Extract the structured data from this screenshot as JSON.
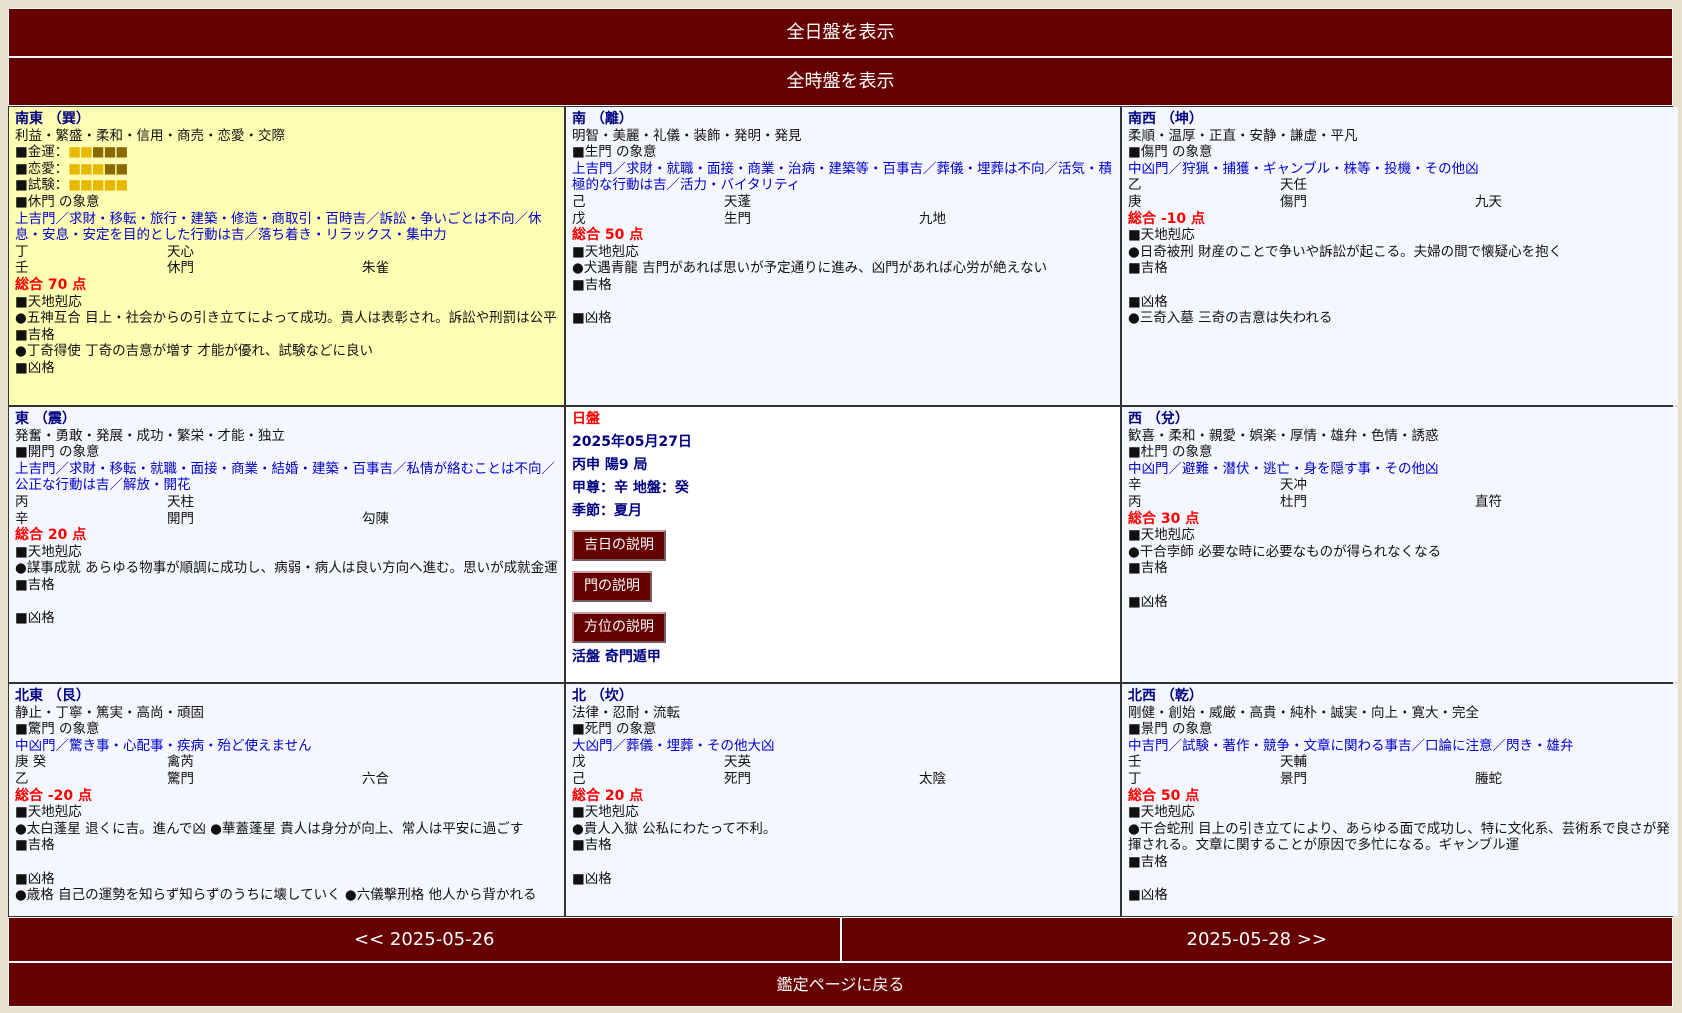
{
  "header": {
    "day_chart_button": "全日盤を表示",
    "hour_chart_button": "全時盤を表示"
  },
  "cells": {
    "se": {
      "direction": "南東 （巽）",
      "keywords": "利益・繁盛・柔和・信用・商売・恋愛・交際",
      "luck": [
        {
          "label": "■金運：",
          "filled": 2,
          "total": 5
        },
        {
          "label": "■恋愛：",
          "filled": 3,
          "total": 5
        },
        {
          "label": "■試験：",
          "filled": 5,
          "total": 5
        }
      ],
      "gate_meaning": "■休門 の象意",
      "gate_text": "上吉門／求財・移転・旅行・建築・修造・商取引・百時吉／訴訟・争いごとは不向／休息・安息・安定を目的とした行動は吉／落ち着き・リラックス・集中力",
      "row1": [
        "丁",
        "天心",
        ""
      ],
      "row2": [
        "壬",
        "休門",
        "朱雀"
      ],
      "score": "総合 70 点",
      "lines": [
        "■天地剋応",
        "●五神互合 目上・社会からの引き立てによって成功。貴人は表彰され。訴訟や刑罰は公平",
        "■吉格",
        "●丁奇得使 丁奇の吉意が増す 才能が優れ、試験などに良い",
        "■凶格"
      ]
    },
    "s": {
      "direction": "南 （離）",
      "keywords": "明智・美麗・礼儀・装飾・発明・発見",
      "gate_meaning": "■生門 の象意",
      "gate_text": "上吉門／求財・就職・面接・商業・治病・建築等・百事吉／葬儀・埋葬は不向／活気・積極的な行動は吉／活力・バイタリティ",
      "row1": [
        "己",
        "天蓬",
        ""
      ],
      "row2": [
        "戊",
        "生門",
        "九地"
      ],
      "score": "総合 50 点",
      "lines": [
        "■天地剋応",
        "●犬遇青龍 吉門があれば思いが予定通りに進み、凶門があれば心労が絶えない",
        "■吉格",
        "",
        "■凶格"
      ]
    },
    "sw": {
      "direction": "南西 （坤）",
      "keywords": "柔順・温厚・正直・安静・謙虚・平凡",
      "gate_meaning": "■傷門 の象意",
      "gate_text": "中凶門／狩猟・捕獲・ギャンブル・株等・投機・その他凶",
      "row1": [
        "乙",
        "天任",
        ""
      ],
      "row2": [
        "庚",
        "傷門",
        "九天"
      ],
      "score": "総合 -10 点",
      "lines": [
        "■天地剋応",
        "●日奇被刑 財産のことで争いや訴訟が起こる。夫婦の間で懐疑心を抱く",
        "■吉格",
        "",
        "■凶格",
        "●三奇入墓 三奇の吉意は失われる"
      ]
    },
    "e": {
      "direction": "東 （震）",
      "keywords": "発奮・勇敢・発展・成功・繁栄・才能・独立",
      "gate_meaning": "■開門 の象意",
      "gate_text": "上吉門／求財・移転・就職・面接・商業・結婚・建築・百事吉／私情が絡むことは不向／公正な行動は吉／解放・開花",
      "row1": [
        "丙",
        "天柱",
        ""
      ],
      "row2": [
        "辛",
        "開門",
        "勾陳"
      ],
      "score": "総合 20 点",
      "lines": [
        "■天地剋応",
        "●謀事成就 あらゆる物事が順調に成功し、病弱・病人は良い方向へ進む。思いが成就金運",
        "■吉格",
        "",
        "■凶格"
      ]
    },
    "center": {
      "title": "日盤",
      "date": "2025年05月27日",
      "line1": "丙申 陽9 局",
      "line2": "甲尊：辛 地盤：癸",
      "line3": "季節：夏月",
      "btn_day": "吉日の説明",
      "btn_gate": "門の説明",
      "btn_dir": "方位の説明",
      "footer": "活盤 奇門遁甲"
    },
    "w": {
      "direction": "西 （兌）",
      "keywords": "歓喜・柔和・親愛・娯楽・厚情・雄弁・色情・誘惑",
      "gate_meaning": "■杜門 の象意",
      "gate_text": "中凶門／避難・潜伏・逃亡・身を隠す事・その他凶",
      "row1": [
        "辛",
        "天冲",
        ""
      ],
      "row2": [
        "丙",
        "杜門",
        "直符"
      ],
      "score": "総合 30 点",
      "lines": [
        "■天地剋応",
        "●干合孛師 必要な時に必要なものが得られなくなる",
        "■吉格",
        "",
        "■凶格"
      ]
    },
    "ne": {
      "direction": "北東 （艮）",
      "keywords": "静止・丁寧・篤実・高尚・頑固",
      "gate_meaning": "■驚門 の象意",
      "gate_text": "中凶門／驚き事・心配事・疾病・殆ど使えません",
      "row1": [
        "庚 癸",
        "禽芮",
        ""
      ],
      "row2": [
        "乙",
        "驚門",
        "六合"
      ],
      "score": "総合 -20 点",
      "lines": [
        "■天地剋応",
        "●太白蓬星 退くに吉。進んで凶 ●華蓋蓬星 貴人は身分が向上、常人は平安に過ごす",
        "■吉格",
        "",
        "■凶格",
        "●歳格 自己の運勢を知らず知らずのうちに壊していく ●六儀擊刑格 他人から背かれる"
      ]
    },
    "n": {
      "direction": "北 （坎）",
      "keywords": "法律・忍耐・流転",
      "gate_meaning": "■死門 の象意",
      "gate_text": "大凶門／葬儀・埋葬・その他大凶",
      "row1": [
        "戊",
        "天英",
        ""
      ],
      "row2": [
        "己",
        "死門",
        "太陰"
      ],
      "score": "総合 20 点",
      "lines": [
        "■天地剋応",
        "●貴人入獄 公私にわたって不利。",
        "■吉格",
        "",
        "■凶格"
      ]
    },
    "nw": {
      "direction": "北西 （乾）",
      "keywords": "剛健・創始・威厳・高貴・純朴・誠実・向上・寛大・完全",
      "gate_meaning": "■景門 の象意",
      "gate_text": "中吉門／試験・著作・競争・文章に関わる事吉／口論に注意／閃き・雄弁",
      "row1": [
        "壬",
        "天輔",
        ""
      ],
      "row2": [
        "丁",
        "景門",
        "螣蛇"
      ],
      "score": "総合 50 点",
      "lines": [
        "■天地剋応",
        "●干合蛇刑 目上の引き立てにより、あらゆる面で成功し、特に文化系、芸術系で良さが発揮される。文章に関することが原因で多忙になる。ギャンブル運",
        "■吉格",
        "",
        "■凶格"
      ]
    }
  },
  "nav": {
    "prev": "<< 2025-05-26",
    "next": "2025-05-28 >>",
    "back": "鑑定ページに戻る"
  },
  "colors": {
    "bar": "#660000",
    "highlight_cell": "#ffffb3",
    "cell": "#f5f7ff",
    "score": "#ff0000",
    "gate_text": "#0000cc",
    "direction": "#000080"
  }
}
